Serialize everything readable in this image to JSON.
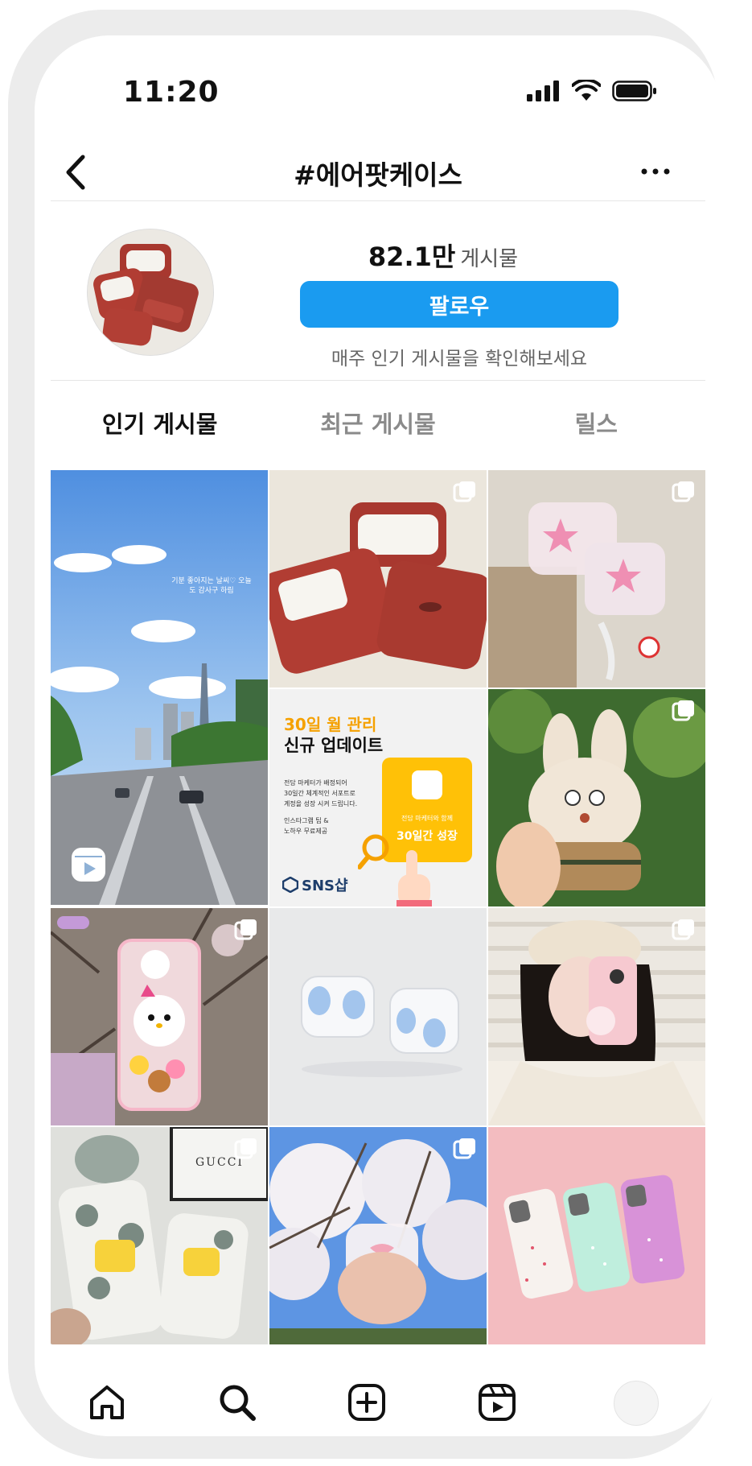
{
  "status_bar": {
    "time": "11:20"
  },
  "header": {
    "title": "#에어팟케이스"
  },
  "profile": {
    "post_count": "82.1만",
    "post_label": "게시물",
    "follow_label": "팔로우",
    "subtitle": "매주 인기 게시물을 확인해보세요"
  },
  "tabs": [
    {
      "label": "인기 게시물",
      "active": true
    },
    {
      "label": "최근 게시물",
      "active": false
    },
    {
      "label": "릴스",
      "active": false
    }
  ],
  "posts": {
    "reel_text": "기분 좋아지는 날씨♡ 오늘도 감사구 하림",
    "promo": {
      "line1": "30일 월 관리",
      "line2": "신규 업데이트",
      "body1": "전담 마케터가 배정되어",
      "body2": "30일간 체계적인 서포트로",
      "body3": "계정을 성장 시켜 드립니다.",
      "body4": "인스타그램 팁 &",
      "body5": "노하우 무료제공",
      "card_small": "전담 마케터와 함께",
      "card_big": "30일간 성장",
      "brand": "SNS샵"
    },
    "gucci_text": "GUCCI"
  },
  "bottom_nav": {
    "icons": [
      "home-icon",
      "search-icon",
      "create-icon",
      "reels-icon",
      "profile-avatar"
    ]
  },
  "colors": {
    "accent": "#1a9bf0",
    "promo_yellow": "#ffc107"
  }
}
